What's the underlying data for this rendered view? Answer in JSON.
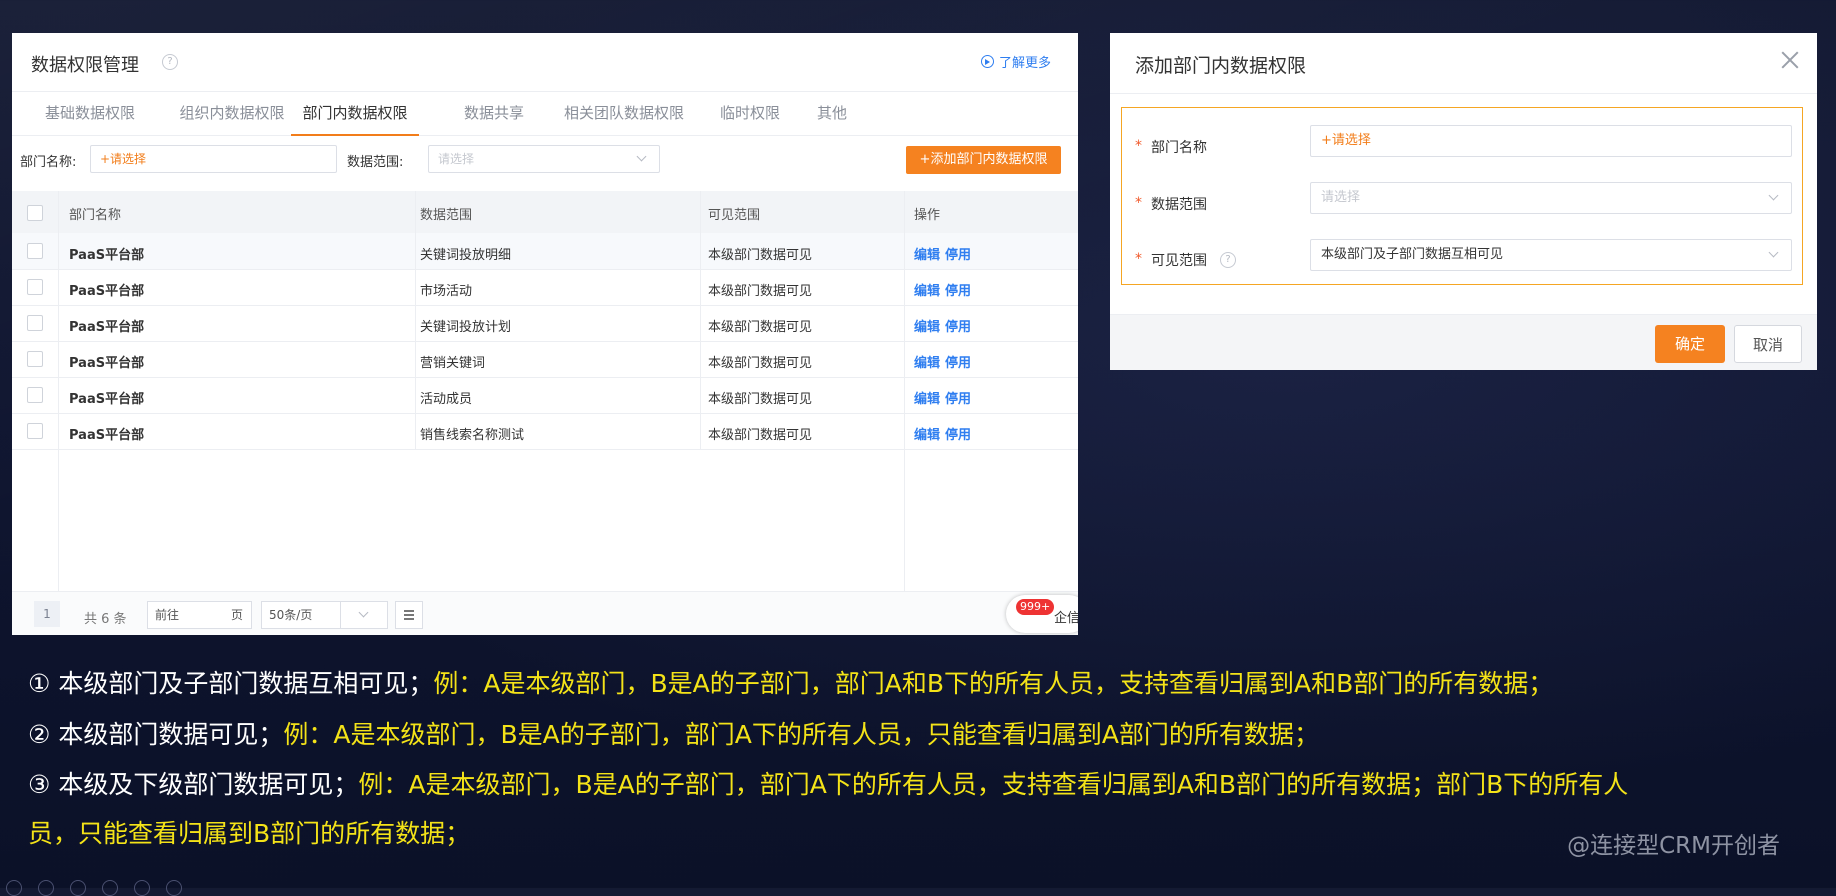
{
  "panel": {
    "title": "数据权限管理",
    "help": "?",
    "learn_more": "了解更多",
    "tabs": [
      {
        "label": "基础数据权限"
      },
      {
        "label": "组织内数据权限"
      },
      {
        "label": "部门内数据权限"
      },
      {
        "label": "数据共享"
      },
      {
        "label": "相关团队数据权限"
      },
      {
        "label": "临时权限"
      },
      {
        "label": "其他"
      }
    ],
    "filter": {
      "dept_label": "部门名称:",
      "dept_value": "+请选择",
      "range_label": "数据范围:",
      "range_placeholder": "请选择",
      "add_button": "+添加部门内数据权限"
    },
    "table": {
      "headers": [
        "部门名称",
        "数据范围",
        "可见范围",
        "操作"
      ],
      "rows": [
        {
          "dept": "PaaS平台部",
          "range": "关键词投放明细",
          "visible": "本级部门数据可见",
          "edit": "编辑",
          "disable": "停用"
        },
        {
          "dept": "PaaS平台部",
          "range": "市场活动",
          "visible": "本级部门数据可见",
          "edit": "编辑",
          "disable": "停用"
        },
        {
          "dept": "PaaS平台部",
          "range": "关键词投放计划",
          "visible": "本级部门数据可见",
          "edit": "编辑",
          "disable": "停用"
        },
        {
          "dept": "PaaS平台部",
          "range": "营销关键词",
          "visible": "本级部门数据可见",
          "edit": "编辑",
          "disable": "停用"
        },
        {
          "dept": "PaaS平台部",
          "range": "活动成员",
          "visible": "本级部门数据可见",
          "edit": "编辑",
          "disable": "停用"
        },
        {
          "dept": "PaaS平台部",
          "range": "销售线索名称测试",
          "visible": "本级部门数据可见",
          "edit": "编辑",
          "disable": "停用"
        }
      ]
    },
    "pager": {
      "page": "1",
      "total": "共 6 条",
      "goto_prefix": "前往",
      "goto_suffix": "页",
      "page_size": "50条/页"
    },
    "qixin": {
      "badge": "999+",
      "label": "企信"
    }
  },
  "dialog": {
    "title": "添加部门内数据权限",
    "fields": [
      {
        "required": "*",
        "label": "部门名称",
        "value": "+请选择"
      },
      {
        "required": "*",
        "label": "数据范围",
        "value": "请选择"
      },
      {
        "required": "*",
        "label": "可见范围",
        "help": "?",
        "value": "本级部门及子部门数据互相可见"
      }
    ],
    "ok": "确定",
    "cancel": "取消"
  },
  "notes": [
    {
      "lead": "① 本级部门及子部门数据互相可见；",
      "detail": "例：A是本级部门，B是A的子部门，部门A和B下的所有人员，支持查看归属到A和B部门的所有数据；"
    },
    {
      "lead": "② 本级部门数据可见；",
      "detail": "例：A是本级部门，B是A的子部门，部门A下的所有人员，只能查看归属到A部门的所有数据；"
    },
    {
      "lead": "③ 本级及下级部门数据可见；",
      "detail": "例：A是本级部门，B是A的子部门，部门A下的所有人员，支持查看归属到A和B部门的所有数据；部门B下的所有人",
      "detail_cont": "员，只能查看归属到B部门的所有数据；"
    }
  ],
  "watermark": "@连接型CRM开创者",
  "colors": {
    "accent": "#f58220",
    "link": "#2f7ef0",
    "note_highlight": "#f4e318"
  }
}
